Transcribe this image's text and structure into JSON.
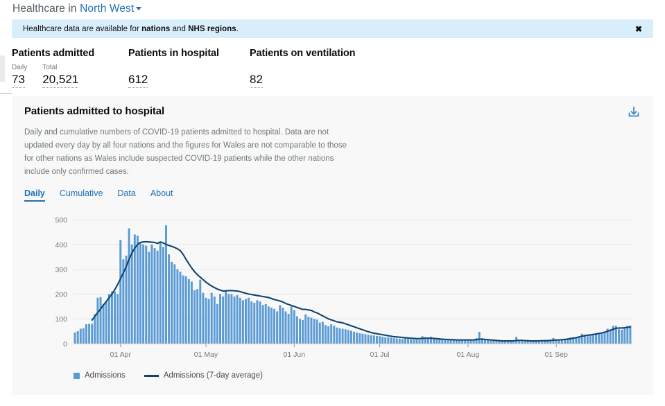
{
  "header": {
    "prefix": "Healthcare in",
    "location": "North West",
    "caret_icon": "chevron-down-icon"
  },
  "banner": {
    "text_before": "Healthcare data are available for ",
    "link1": "nations",
    "text_middle": " and ",
    "link2": "NHS regions",
    "text_after": ".",
    "close_icon": "✖"
  },
  "metrics": [
    {
      "title": "Patients admitted",
      "values": [
        {
          "label": "Daily",
          "value": "73"
        },
        {
          "label": "Total",
          "value": "20,521"
        }
      ]
    },
    {
      "title": "Patients in hospital",
      "values": [
        {
          "label": "",
          "value": "612"
        }
      ]
    },
    {
      "title": "Patients on ventilation",
      "values": [
        {
          "label": "",
          "value": "82"
        }
      ]
    }
  ],
  "card": {
    "title": "Patients admitted to hospital",
    "description": "Daily and cumulative numbers of COVID-19 patients admitted to hospital. Data are not updated every day by all four nations and the figures for Wales are not comparable to those for other nations as Wales include suspected COVID-19 patients while the other nations include only confirmed cases.",
    "download_icon": "download-icon",
    "tabs": [
      {
        "label": "Daily",
        "active": true
      },
      {
        "label": "Cumulative",
        "active": false
      },
      {
        "label": "Data",
        "active": false
      },
      {
        "label": "About",
        "active": false
      }
    ]
  },
  "colors": {
    "bar": "#5b9bd5",
    "line": "#12436d",
    "accent": "#1d70b8",
    "banner_bg": "#d9eefb",
    "card_bg": "#f8f8f8",
    "grid": "#e7e7e7",
    "axis_text": "#6f777b"
  },
  "chart_data": {
    "type": "bar",
    "title": "Patients admitted to hospital",
    "xlabel": "",
    "ylabel": "",
    "ylim": [
      0,
      500
    ],
    "yticks": [
      0,
      100,
      200,
      300,
      400,
      500
    ],
    "grid": true,
    "legend_position": "bottom-left",
    "xticks": [
      {
        "label": "01 Apr",
        "index": 16
      },
      {
        "label": "01 May",
        "index": 46
      },
      {
        "label": "01 Jun",
        "index": 77
      },
      {
        "label": "01 Jul",
        "index": 107
      },
      {
        "label": "01 Aug",
        "index": 138
      },
      {
        "label": "01 Sep",
        "index": 169
      }
    ],
    "series": [
      {
        "name": "Admissions",
        "type": "bar",
        "color": "#5b9bd5",
        "values": [
          45,
          50,
          60,
          62,
          78,
          80,
          80,
          120,
          185,
          188,
          160,
          170,
          200,
          210,
          210,
          200,
          418,
          340,
          355,
          465,
          400,
          440,
          435,
          410,
          400,
          395,
          370,
          400,
          385,
          375,
          410,
          390,
          477,
          360,
          330,
          320,
          300,
          290,
          275,
          272,
          260,
          250,
          215,
          220,
          258,
          205,
          185,
          180,
          205,
          190,
          160,
          200,
          190,
          215,
          200,
          200,
          190,
          195,
          185,
          175,
          180,
          185,
          170,
          165,
          175,
          170,
          155,
          160,
          150,
          145,
          140,
          130,
          155,
          145,
          130,
          120,
          150,
          135,
          110,
          100,
          95,
          118,
          108,
          105,
          100,
          97,
          85,
          88,
          75,
          70,
          78,
          72,
          65,
          62,
          60,
          58,
          55,
          52,
          48,
          45,
          42,
          40,
          38,
          36,
          34,
          33,
          31,
          30,
          28,
          26,
          25,
          24,
          22,
          21,
          20,
          19,
          24,
          20,
          18,
          17,
          16,
          15,
          30,
          26,
          22,
          28,
          20,
          18,
          17,
          16,
          15,
          16,
          15,
          14,
          14,
          13,
          13,
          14,
          18,
          16,
          14,
          22,
          47,
          22,
          16,
          14,
          12,
          11,
          10,
          10,
          9,
          9,
          10,
          9,
          8,
          28,
          10,
          9,
          9,
          10,
          9,
          10,
          12,
          11,
          14,
          12,
          11,
          13,
          23,
          15,
          14,
          18,
          16,
          22,
          25,
          26,
          24,
          30,
          40,
          36,
          30,
          33,
          38,
          42,
          40,
          44,
          48,
          60,
          55,
          72,
          72,
          58,
          56,
          66,
          72,
          73
        ]
      },
      {
        "name": "Admissions (7-day average)",
        "type": "line",
        "color": "#12436d",
        "values": [
          null,
          null,
          null,
          null,
          null,
          null,
          95,
          110,
          125,
          140,
          155,
          170,
          185,
          200,
          218,
          238,
          262,
          285,
          310,
          340,
          365,
          385,
          400,
          408,
          410,
          411,
          410,
          409,
          408,
          404,
          410,
          406,
          400,
          396,
          392,
          388,
          382,
          375,
          360,
          340,
          322,
          305,
          290,
          278,
          268,
          258,
          248,
          240,
          232,
          226,
          220,
          216,
          212,
          213,
          214,
          214,
          213,
          212,
          210,
          206,
          203,
          200,
          198,
          196,
          194,
          192,
          190,
          188,
          186,
          182,
          178,
          175,
          172,
          168,
          162,
          158,
          154,
          150,
          146,
          142,
          138,
          138,
          136,
          134,
          128,
          124,
          118,
          112,
          106,
          100,
          96,
          92,
          88,
          86,
          84,
          80,
          76,
          72,
          68,
          64,
          60,
          56,
          52,
          48,
          45,
          42,
          40,
          38,
          36,
          34,
          32,
          30,
          28,
          27,
          26,
          25,
          24,
          23,
          22,
          21,
          20,
          20,
          21,
          22,
          22,
          22,
          21,
          20,
          19,
          18,
          17,
          17,
          16,
          16,
          15,
          15,
          15,
          15,
          15,
          15,
          15,
          16,
          18,
          18,
          17,
          16,
          15,
          14,
          13,
          12,
          11,
          11,
          11,
          11,
          11,
          13,
          13,
          13,
          12,
          12,
          11,
          11,
          11,
          11,
          12,
          12,
          12,
          13,
          14,
          15,
          15,
          16,
          17,
          18,
          20,
          22,
          24,
          27,
          30,
          32,
          34,
          35,
          37,
          39,
          41,
          43,
          46,
          50,
          54,
          58,
          62,
          63,
          63,
          64,
          66,
          67
        ]
      }
    ]
  }
}
